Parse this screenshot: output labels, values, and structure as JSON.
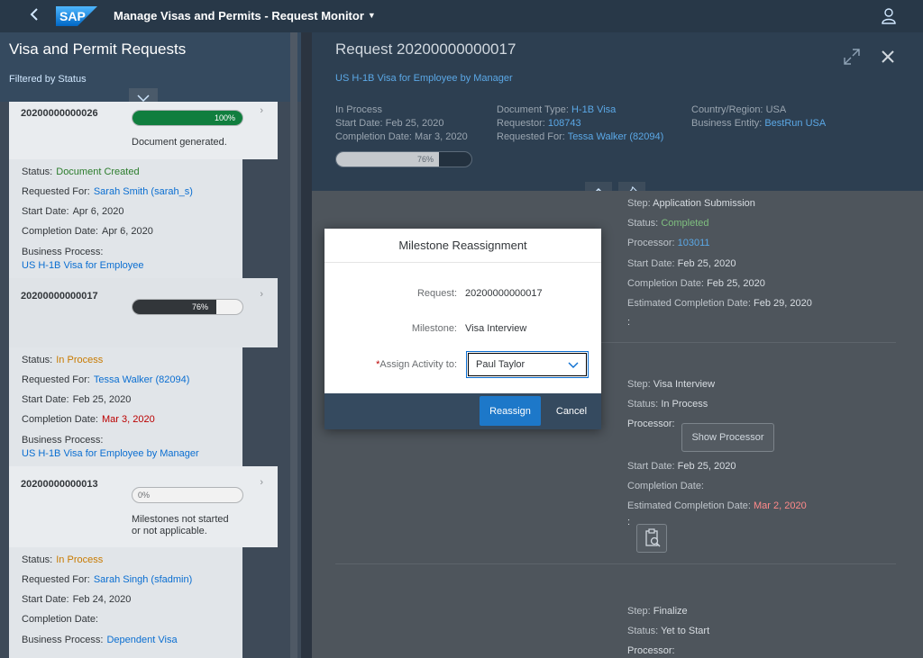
{
  "shell": {
    "logo_text": "SAP",
    "app_title": "Manage Visas and Permits - Request Monitor",
    "user_icon": "person-icon",
    "back_icon": "chevron-left-icon"
  },
  "master": {
    "title": "Visa and Permit Requests",
    "filter_info": "Filtered by Status",
    "items": [
      {
        "id": "20200000000026",
        "progress_label": "100%",
        "progress": 1.0,
        "progress_color": "#107e3e",
        "note": "Document generated.",
        "status_label": "Status:",
        "status": "Document Created",
        "requested_for_label": "Requested For:",
        "requested_for": "Sarah Smith (sarah_s)",
        "start_label": "Start Date:",
        "start": "Apr 6, 2020",
        "completion_label": "Completion Date:",
        "completion": "Apr 6, 2020",
        "process_label": "Business Process:",
        "process": "US H-1B Visa for Employee"
      },
      {
        "id": "20200000000017",
        "progress_label": "76%",
        "progress": 0.76,
        "progress_color": "#32363a",
        "status_label": "Status:",
        "status": "In Process",
        "requested_for_label": "Requested For:",
        "requested_for": "Tessa Walker (82094)",
        "start_label": "Start Date:",
        "start": "Feb 25, 2020",
        "completion_label": "Completion Date:",
        "completion": "Mar 3, 2020",
        "process_label": "Business Process:",
        "process": "US H-1B Visa for Employee by Manager"
      },
      {
        "id": "20200000000013",
        "progress_label": "0%",
        "progress": 0.0,
        "note_line1": "Milestones not started",
        "note_line2": "or not applicable.",
        "status_label": "Status:",
        "status": "In Process",
        "requested_for_label": "Requested For:",
        "requested_for": "Sarah Singh (sfadmin)",
        "start_label": "Start Date:",
        "start": "Feb 24, 2020",
        "completion_label": "Completion Date:",
        "completion": "",
        "process_label": "Business Process:",
        "process": "Dependent Visa"
      }
    ]
  },
  "detail": {
    "title": "Request 20200000000017",
    "subtitle": "US H-1B Visa for Employee by Manager",
    "col1": {
      "status": "In Process",
      "start": "Start Date: Feb 25, 2020",
      "completion": "Completion Date: Mar 3, 2020"
    },
    "col2": {
      "doc_type_label": "Document Type:",
      "doc_type": "H-1B Visa",
      "requestor_label": "Requestor:",
      "requestor": "108743",
      "requested_for_label": "Requested For:",
      "requested_for": "Tessa Walker (82094)"
    },
    "col3": {
      "country_label": "Country/Region:",
      "country": "USA",
      "entity_label": "Business Entity:",
      "entity": "BestRun USA"
    },
    "progress_label": "76%",
    "progress": 0.76,
    "steps": [
      {
        "step_label": "Step:",
        "step": "Application Submission",
        "status_label": "Status:",
        "status": "Completed",
        "processor_label": "Processor:",
        "processor": "103011",
        "start_label": "Start Date:",
        "start": "Feb 25, 2020",
        "completion_label": "Completion Date:",
        "completion": "Feb 25, 2020",
        "est_label": "Estimated Completion Date:",
        "est": "Feb 29, 2020",
        "colon": ":"
      },
      {
        "step_label": "Step:",
        "step": "Visa Interview",
        "status_label": "Status:",
        "status": "In Process",
        "processor_label": "Processor:",
        "show_processor_label": "Show Processor",
        "start_label": "Start Date:",
        "start": "Feb 25, 2020",
        "completion_label": "Completion Date:",
        "completion": "",
        "est_label": "Estimated Completion Date:",
        "est": "Mar 2, 2020",
        "colon": ":"
      },
      {
        "step_label": "Step:",
        "step": "Finalize",
        "status_label": "Status:",
        "status": "Yet to Start",
        "processor_label": "Processor:"
      }
    ]
  },
  "dialog": {
    "title": "Milestone Reassignment",
    "request_label": "Request:",
    "request_value": "20200000000017",
    "milestone_label": "Milestone:",
    "milestone_value": "Visa Interview",
    "required_mark": "*",
    "assign_label": "Assign Activity to:",
    "assign_value": "Paul Taylor",
    "reassign_button": "Reassign",
    "cancel_button": "Cancel"
  }
}
